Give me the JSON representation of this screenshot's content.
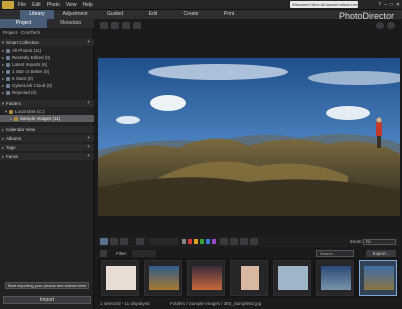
{
  "menu": [
    "File",
    "Edit",
    "Photo",
    "View",
    "Help"
  ],
  "welcome": "Welcome! View all tutorial videos here!",
  "window_buttons": [
    "?",
    "–",
    "□",
    "✕"
  ],
  "modules": [
    {
      "label": "Library",
      "active": true
    },
    {
      "label": "Adjustment",
      "active": false
    },
    {
      "label": "Guided",
      "active": false
    },
    {
      "label": "Edit",
      "active": false
    },
    {
      "label": "Create",
      "active": false
    },
    {
      "label": "Print",
      "active": false
    }
  ],
  "brand": "PhotoDirector",
  "left_tabs": [
    {
      "label": "Project",
      "active": true
    },
    {
      "label": "Metadata",
      "active": false
    }
  ],
  "project_title": "Project - ComTech",
  "tree": {
    "smart_collection": "Smart Collection",
    "items": [
      "All Photos (11)",
      "Recently Edited (0)",
      "Latest Imports (6)",
      "1 Star or Better (0)",
      "5 Stars (0)",
      "CyberLink Cloud (0)",
      "Rejected (0)"
    ],
    "folders": "Folders",
    "local_disk": "Local Disk (C:)",
    "sample_folder": "Sample Images (11)",
    "calendar": "Calendar View",
    "albums": "Albums",
    "tags": "Tags",
    "faces": "Faces"
  },
  "tooltip": "Start importing your photos and videos here!",
  "import_label": "Import",
  "filter_label": "Filter:",
  "search_placeholder": "Search",
  "export_label": "Export...",
  "zoom_label": "Zoom:",
  "zoom_value": "Fit",
  "status": {
    "count": "1 selected - 11 displayed",
    "path": "Folders / Sample Images / 360_Sample02.jpg"
  },
  "color_labels": [
    "#888888",
    "#d23a3a",
    "#e0a020",
    "#3aa03a",
    "#3a7ad2",
    "#9a4ac8"
  ]
}
